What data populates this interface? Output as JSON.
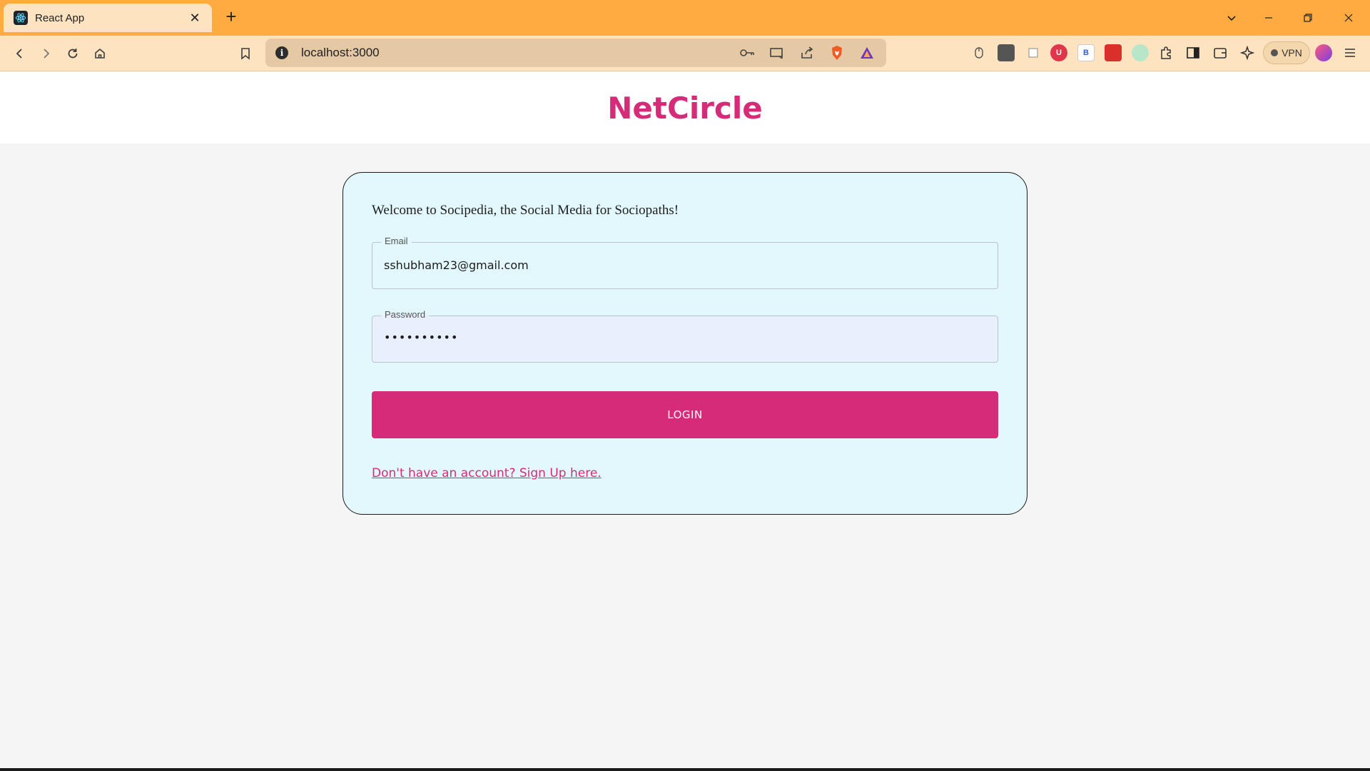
{
  "browser": {
    "tab": {
      "title": "React App"
    },
    "address_bar": {
      "url": "localhost:3000"
    },
    "vpn_label": "VPN",
    "extension_b_label": "B",
    "extension_u_label": "U",
    "icons": [
      "back-icon",
      "forward-icon",
      "reload-icon",
      "home-icon",
      "bookmark-icon",
      "info-icon",
      "key-icon",
      "cast-icon",
      "share-icon",
      "brave-shield-icon",
      "rewards-icon",
      "extensions-icon",
      "sidebar-icon",
      "wallet-icon",
      "leo-icon",
      "profile-icon",
      "menu-icon"
    ]
  },
  "app": {
    "brand": "NetCircle",
    "accent_color": "#d62b78",
    "card_background": "#e2f8fc"
  },
  "login_form": {
    "welcome_text": "Welcome to Socipedia, the Social Media for Sociopaths!",
    "email": {
      "label": "Email",
      "value": "sshubham23@gmail.com"
    },
    "password": {
      "label": "Password",
      "value": "••••••••••"
    },
    "submit_label": "LOGIN",
    "signup_link": "Don't have an account? Sign Up here."
  }
}
